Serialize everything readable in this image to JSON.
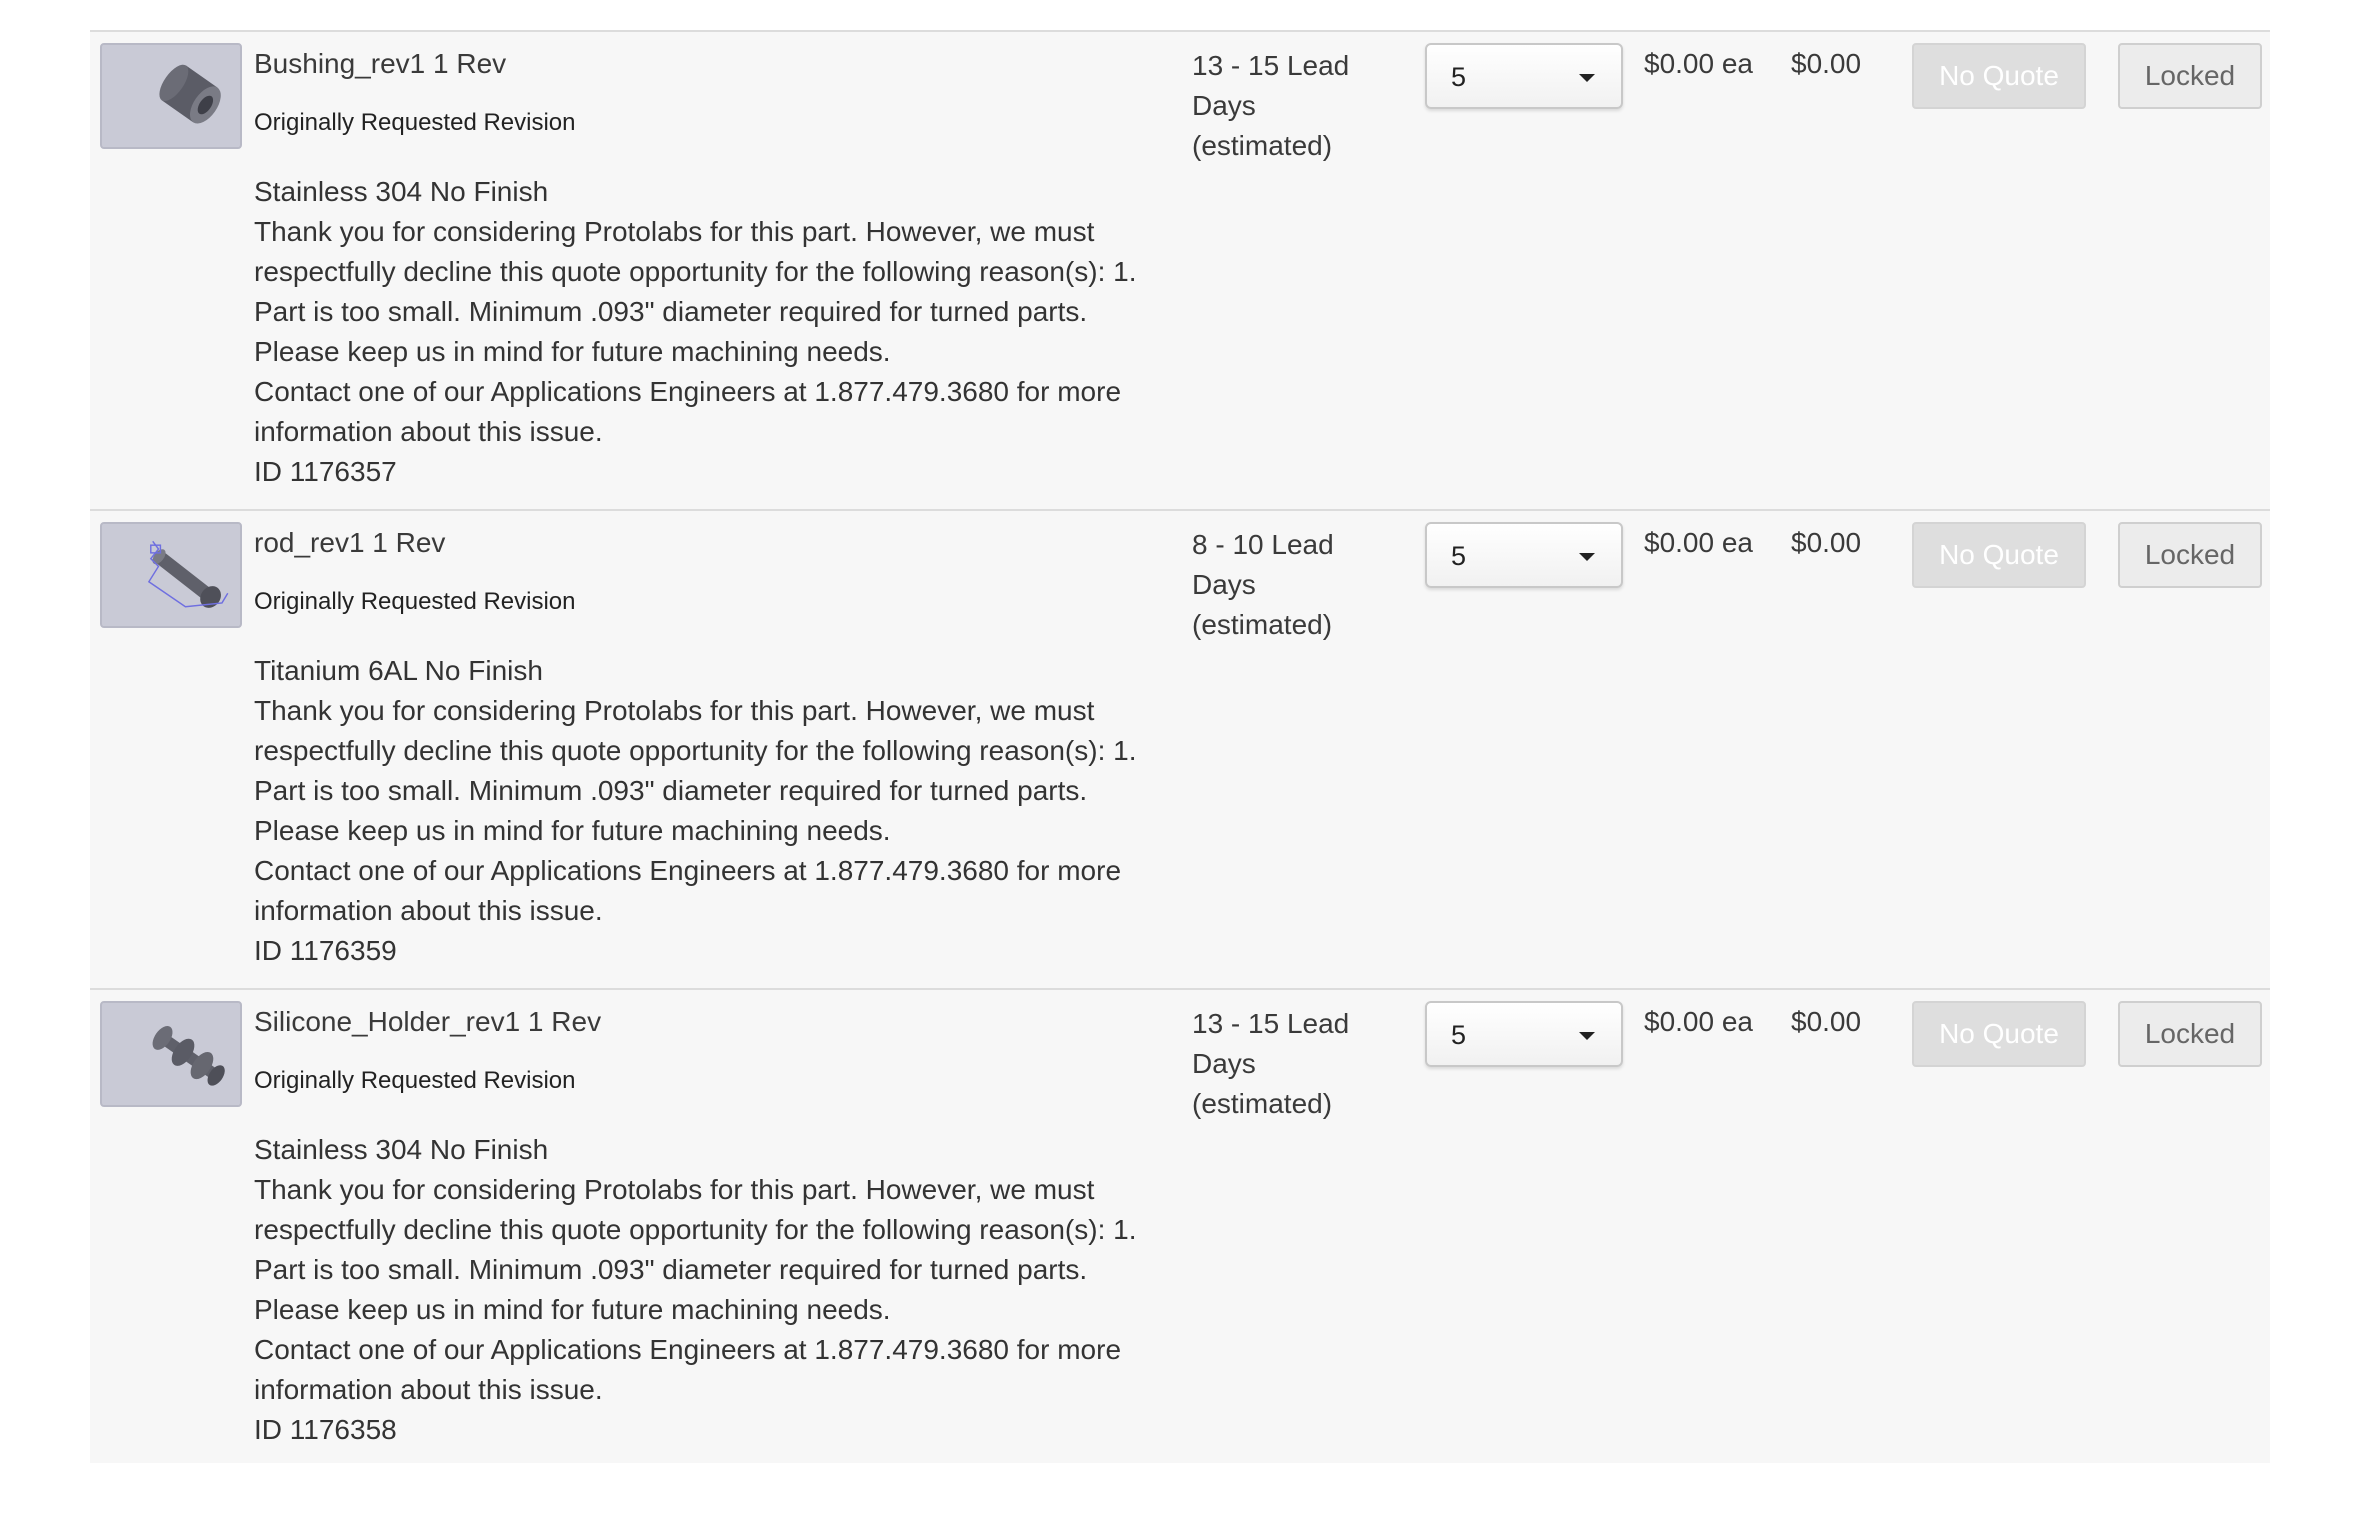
{
  "parts": [
    {
      "name": "Bushing_rev1 1 Rev",
      "revision": "Originally Requested Revision",
      "material": "Stainless 304 No Finish",
      "message_lines": [
        "Thank you for considering Protolabs for this part. However, we must",
        "respectfully decline this quote opportunity for the following reason(s): 1.",
        "Part is too small. Minimum .093\" diameter required for turned parts.",
        "Please keep us in mind for future machining needs.",
        "Contact one of our Applications Engineers at 1.877.479.3680 for more",
        "information about this issue."
      ],
      "id": "ID 1176357",
      "lead_time": [
        "13 - 15 Lead",
        "Days",
        "(estimated)"
      ],
      "quantity": "5",
      "unit_price": "$0.00 ea",
      "total": "$0.00",
      "quote_button": "No Quote",
      "status_button": "Locked",
      "thumbnail_icon": "bushing-part-icon"
    },
    {
      "name": "rod_rev1 1 Rev",
      "revision": "Originally Requested Revision",
      "material": "Titanium 6AL No Finish",
      "message_lines": [
        "Thank you for considering Protolabs for this part. However, we must",
        "respectfully decline this quote opportunity for the following reason(s): 1.",
        "Part is too small. Minimum .093\" diameter required for turned parts.",
        "Please keep us in mind for future machining needs.",
        "Contact one of our Applications Engineers at 1.877.479.3680 for more",
        "information about this issue."
      ],
      "id": "ID 1176359",
      "lead_time": [
        "8 - 10 Lead",
        "Days",
        "(estimated)"
      ],
      "quantity": "5",
      "unit_price": "$0.00 ea",
      "total": "$0.00",
      "quote_button": "No Quote",
      "status_button": "Locked",
      "thumbnail_icon": "rod-part-icon"
    },
    {
      "name": "Silicone_Holder_rev1 1 Rev",
      "revision": "Originally Requested Revision",
      "material": "Stainless 304 No Finish",
      "message_lines": [
        "Thank you for considering Protolabs for this part. However, we must",
        "respectfully decline this quote opportunity for the following reason(s): 1.",
        "Part is too small. Minimum .093\" diameter required for turned parts.",
        "Please keep us in mind for future machining needs.",
        "Contact one of our Applications Engineers at 1.877.479.3680 for more",
        "information about this issue."
      ],
      "id": "ID 1176358",
      "lead_time": [
        "13 - 15 Lead",
        "Days",
        "(estimated)"
      ],
      "quantity": "5",
      "unit_price": "$0.00 ea",
      "total": "$0.00",
      "quote_button": "No Quote",
      "status_button": "Locked",
      "thumbnail_icon": "silicone-holder-part-icon"
    }
  ],
  "colors": {
    "row_background": "#f7f7f7",
    "divider": "#dcdcdc",
    "thumbnail_background": "#c9cad6",
    "no_quote_button": "#dedede",
    "locked_button": "#ececec"
  }
}
